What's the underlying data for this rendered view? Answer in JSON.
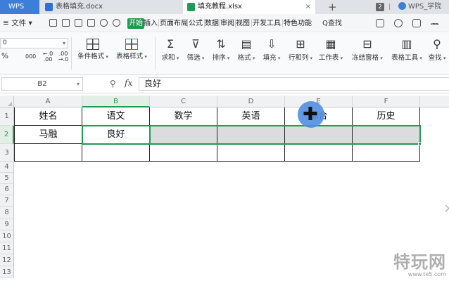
{
  "titlebar": {
    "brand": "WPS",
    "tabs": [
      {
        "label": "表格填充.docx"
      },
      {
        "label": "填充教程.xlsx"
      }
    ],
    "tab_close": "×",
    "add": "+",
    "window_badge": "2",
    "separator": "|",
    "account": "WPS_学院"
  },
  "menubar": {
    "file": "≡ 文件 ▾",
    "tabs": [
      "开始",
      "插入",
      "页面布局",
      "公式",
      "数据",
      "审阅",
      "视图",
      "开发工具",
      "特色功能"
    ],
    "active_tab": "开始",
    "search": "Q查找"
  },
  "ribbon": {
    "font_value": "0",
    "number_formats": [
      "%",
      "000",
      "←.0 .00",
      ".00 →.0"
    ],
    "buttons": [
      {
        "label": "条件格式",
        "icon": "conditional-format-icon"
      },
      {
        "label": "表格样式",
        "icon": "table-style-icon"
      },
      {
        "label": "求和",
        "icon": "sum-icon",
        "glyph": "Σ"
      },
      {
        "label": "筛选",
        "icon": "filter-icon",
        "glyph": "⊽"
      },
      {
        "label": "排序",
        "icon": "sort-icon",
        "glyph": "⇅"
      },
      {
        "label": "格式",
        "icon": "format-icon",
        "glyph": "▤"
      },
      {
        "label": "填充",
        "icon": "fill-icon",
        "glyph": "⇩"
      },
      {
        "label": "行和列",
        "icon": "rows-cols-icon",
        "glyph": "⊞"
      },
      {
        "label": "工作表",
        "icon": "worksheet-icon",
        "glyph": "▦"
      },
      {
        "label": "冻结窗格",
        "icon": "freeze-panes-icon",
        "glyph": "⊟"
      },
      {
        "label": "表格工具",
        "icon": "table-tools-icon",
        "glyph": "▥"
      },
      {
        "label": "查找",
        "icon": "find-icon",
        "glyph": "⚲"
      }
    ]
  },
  "formula_bar": {
    "name_box": "B2",
    "fx": "fx",
    "value": "良好"
  },
  "sheet": {
    "columns": [
      "A",
      "B",
      "C",
      "D",
      "E",
      "F"
    ],
    "selected_column": "B",
    "rows": [
      "1",
      "2",
      "3",
      "4",
      "5",
      "6",
      "7",
      "8",
      "9",
      "10",
      "11",
      "12",
      "13"
    ],
    "selected_row": "2",
    "cells": [
      [
        "姓名",
        "语文",
        "数学",
        "英语",
        "综合",
        "历史"
      ],
      [
        "马融",
        "良好",
        "",
        "",
        "",
        ""
      ],
      [
        "",
        "",
        "",
        "",
        "",
        ""
      ]
    ],
    "active_cell": "B2",
    "selection_range": "B2:F2"
  },
  "watermark": {
    "main": "特玩网",
    "sub": "www.te5.com"
  }
}
